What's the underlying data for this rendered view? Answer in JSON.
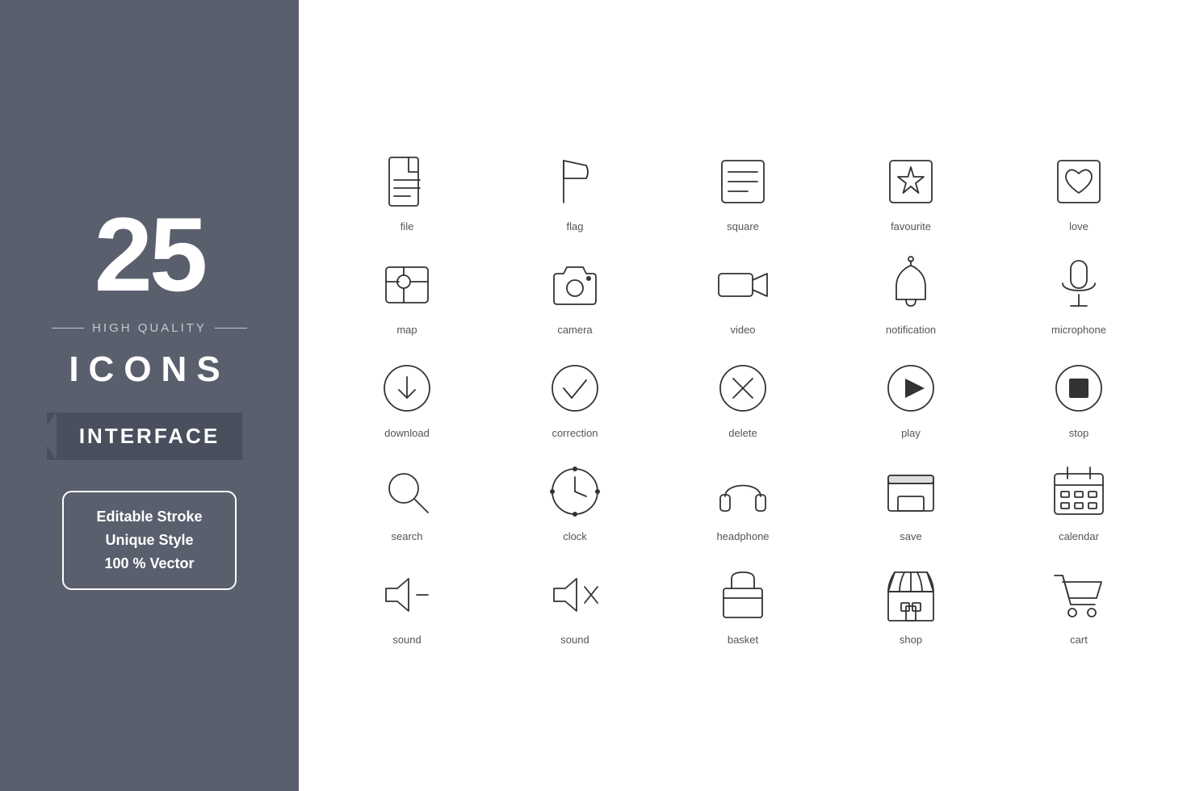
{
  "left": {
    "number": "25",
    "hq_label": "HIGH QUALITY",
    "icons_label": "ICONS",
    "category": "INTERFACE",
    "features": [
      "Editable Stroke",
      "Unique Style",
      "100 % Vector"
    ]
  },
  "icons": [
    {
      "name": "file",
      "label": "file"
    },
    {
      "name": "flag",
      "label": "flag"
    },
    {
      "name": "square",
      "label": "square"
    },
    {
      "name": "favourite",
      "label": "favourite"
    },
    {
      "name": "love",
      "label": "love"
    },
    {
      "name": "map",
      "label": "map"
    },
    {
      "name": "camera",
      "label": "camera"
    },
    {
      "name": "video",
      "label": "video"
    },
    {
      "name": "notification",
      "label": "notification"
    },
    {
      "name": "microphone",
      "label": "microphone"
    },
    {
      "name": "download",
      "label": "download"
    },
    {
      "name": "correction",
      "label": "correction"
    },
    {
      "name": "delete",
      "label": "delete"
    },
    {
      "name": "play",
      "label": "play"
    },
    {
      "name": "stop",
      "label": "stop"
    },
    {
      "name": "search",
      "label": "search"
    },
    {
      "name": "clock",
      "label": "clock"
    },
    {
      "name": "headphone",
      "label": "headphone"
    },
    {
      "name": "save",
      "label": "save"
    },
    {
      "name": "calendar",
      "label": "calendar"
    },
    {
      "name": "sound-minus",
      "label": "sound"
    },
    {
      "name": "sound-mute",
      "label": "sound"
    },
    {
      "name": "basket",
      "label": "basket"
    },
    {
      "name": "shop",
      "label": "shop"
    },
    {
      "name": "cart",
      "label": "cart"
    }
  ]
}
